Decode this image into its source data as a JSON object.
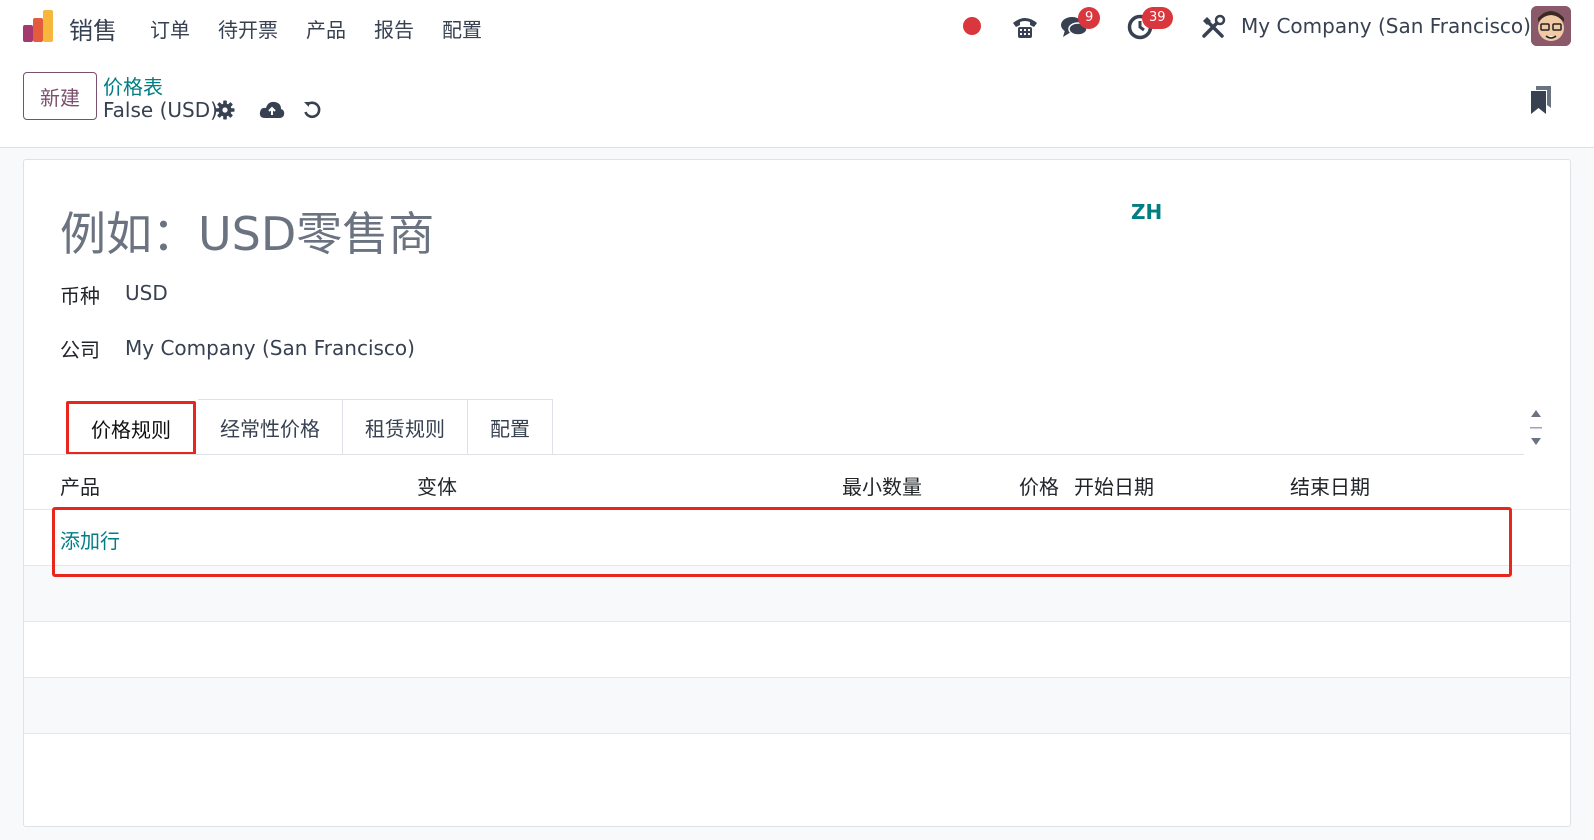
{
  "navbar": {
    "app_name": "销售",
    "menu": [
      "订单",
      "待开票",
      "产品",
      "报告",
      "配置"
    ],
    "messages_badge": "9",
    "activities_badge": "39",
    "company": "My Company (San Francisco)"
  },
  "control_panel": {
    "new_label": "新建",
    "breadcrumb_parent": "价格表",
    "breadcrumb_current": "False (USD)"
  },
  "form": {
    "name_placeholder": "例如：USD零售商",
    "lang_code": "ZH",
    "currency_label": "币种",
    "currency_value": "USD",
    "company_label": "公司",
    "company_value": "My Company (San Francisco)"
  },
  "tabs": [
    "价格规则",
    "经常性价格",
    "租赁规则",
    "配置"
  ],
  "table": {
    "columns": [
      "产品",
      "变体",
      "最小数量",
      "价格",
      "开始日期",
      "结束日期"
    ],
    "add_line": "添加行"
  },
  "colors": {
    "brand": "#7c4f6e",
    "link": "#017e84",
    "badge": "#d9363e",
    "highlight": "#e8261c"
  }
}
